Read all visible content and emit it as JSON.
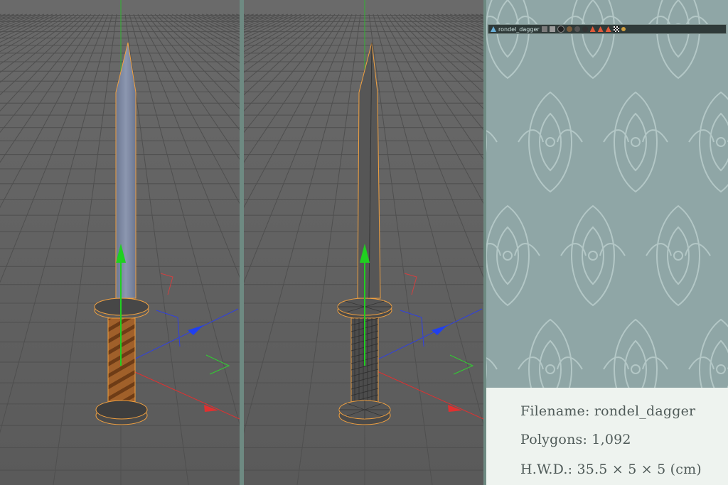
{
  "scene_bar": {
    "object_name": "rondel_dagger",
    "icons": [
      "layer-icon",
      "lock-icon",
      "display-sphere-icon",
      "material-icon",
      "material-icon",
      "material-icon",
      "tag-icon",
      "tag-icon",
      "tag-icon",
      "texture-tag-icon",
      "constraint-icon"
    ]
  },
  "info": {
    "filename_label": "Filename: rondel_dagger",
    "polygons_label": "Polygons: 1,092",
    "dimensions_label": "H.W.D.: 35.5 × 5 × 5 (cm)"
  },
  "colors": {
    "viewport_bg": "#5f5f5f",
    "selection_outline": "#f0a040",
    "axis_x": "#e03030",
    "axis_y": "#30d030",
    "axis_z": "#3040e0",
    "blade": "#7e8aa3",
    "grip": "#a5602a",
    "panel_bg": "#8fa6a6",
    "info_bg": "#eef3ef"
  }
}
